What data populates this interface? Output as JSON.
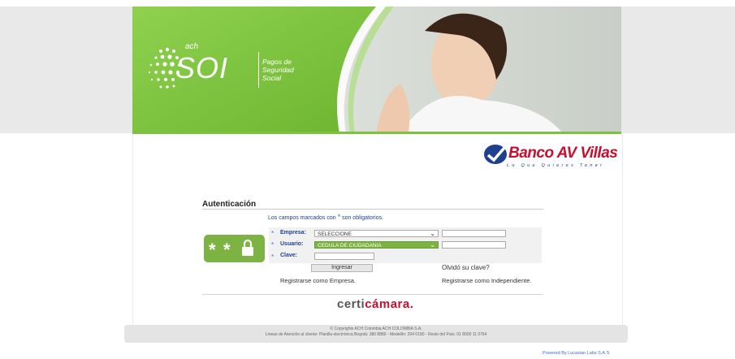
{
  "banner": {
    "brand_small": "ach",
    "brand": "SOI",
    "tagline": "Pagos de Seguridad Social"
  },
  "bank": {
    "name": "Banco AV Villas",
    "slogan": "Lo Que Quieres Tener"
  },
  "auth": {
    "title": "Autenticación",
    "note_before": "Los campos marcados con",
    "note_star": "*",
    "note_after": "son obligatorios.",
    "fields": {
      "empresa": {
        "label": "Empresa:",
        "value": "SELECCIONE"
      },
      "usuario": {
        "label": "Usuario:",
        "value": "CEDULA DE CIUDADANIA"
      },
      "clave": {
        "label": "Clave:"
      }
    },
    "submit": "Ingresar",
    "forgot": "Olvidó su clave?",
    "register_company": "Registrarse como Empresa.",
    "register_independent": "Registrarse como Independiente."
  },
  "certicamara": {
    "name_a": "certi",
    "name_b": "cámara."
  },
  "footer": {
    "copyright": "© Copyrights ACH Colombia ACH COLOMBIA S.A.",
    "contact": "Líneas de Atención al cliente: Planilla electrónica Bogotá: 380 8880 - Medellín: 204 0180 - Resto del País: 01 8000 11 0764"
  },
  "powered": "Powered By Lucasian Labs S.A.S",
  "colors": {
    "accent_green": "#7cb342",
    "bank_red": "#c8102e",
    "link_blue": "#1f3f8f"
  }
}
